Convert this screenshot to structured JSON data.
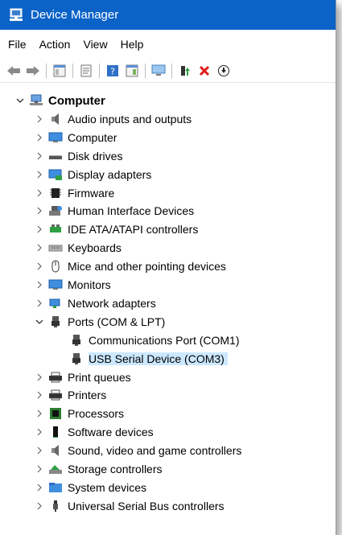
{
  "window": {
    "title": "Device Manager"
  },
  "menu": {
    "items": [
      "File",
      "Action",
      "View",
      "Help"
    ]
  },
  "tree": {
    "root": "Computer",
    "items": [
      {
        "label": "Audio inputs and outputs",
        "icon": "speaker-icon",
        "expanded": false
      },
      {
        "label": "Computer",
        "icon": "monitor-icon",
        "expanded": false
      },
      {
        "label": "Disk drives",
        "icon": "disk-drive-icon",
        "expanded": false
      },
      {
        "label": "Display adapters",
        "icon": "display-adapter-icon",
        "expanded": false
      },
      {
        "label": "Firmware",
        "icon": "firmware-chip-icon",
        "expanded": false
      },
      {
        "label": "Human Interface Devices",
        "icon": "hid-icon",
        "expanded": false
      },
      {
        "label": "IDE ATA/ATAPI controllers",
        "icon": "ide-controller-icon",
        "expanded": false
      },
      {
        "label": "Keyboards",
        "icon": "keyboard-icon",
        "expanded": false
      },
      {
        "label": "Mice and other pointing devices",
        "icon": "mouse-icon",
        "expanded": false
      },
      {
        "label": "Monitors",
        "icon": "monitor-icon",
        "expanded": false
      },
      {
        "label": "Network adapters",
        "icon": "network-adapter-icon",
        "expanded": false
      },
      {
        "label": "Ports (COM & LPT)",
        "icon": "port-plug-icon",
        "expanded": true,
        "children": [
          {
            "label": "Communications Port (COM1)",
            "icon": "port-plug-icon",
            "selected": false
          },
          {
            "label": "USB Serial Device (COM3)",
            "icon": "port-plug-icon",
            "selected": true
          }
        ]
      },
      {
        "label": "Print queues",
        "icon": "printer-icon",
        "expanded": false
      },
      {
        "label": "Printers",
        "icon": "printer-icon",
        "expanded": false
      },
      {
        "label": "Processors",
        "icon": "processor-icon",
        "expanded": false
      },
      {
        "label": "Software devices",
        "icon": "software-device-icon",
        "expanded": false
      },
      {
        "label": "Sound, video and game controllers",
        "icon": "speaker-icon",
        "expanded": false
      },
      {
        "label": "Storage controllers",
        "icon": "storage-controller-icon",
        "expanded": false
      },
      {
        "label": "System devices",
        "icon": "folder-icon",
        "expanded": false
      },
      {
        "label": "Universal Serial Bus controllers",
        "icon": "usb-plug-icon",
        "expanded": false
      }
    ]
  },
  "colors": {
    "titlebar": "#0b63c8",
    "selection": "#cce8ff"
  }
}
